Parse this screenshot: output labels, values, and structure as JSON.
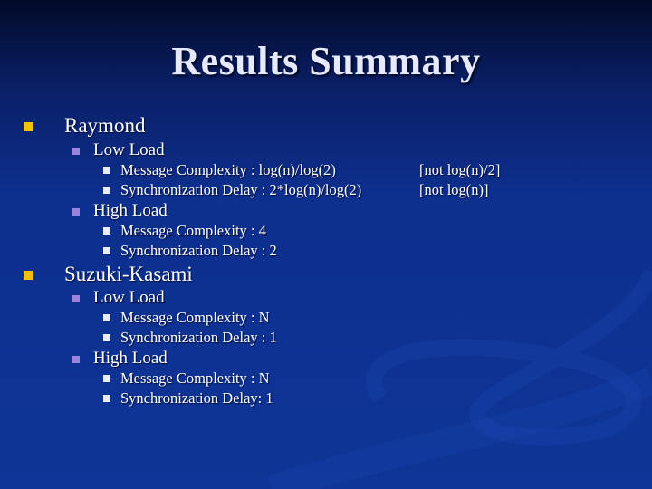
{
  "slide": {
    "title": "Results Summary",
    "sections": [
      {
        "label": "Raymond",
        "groups": [
          {
            "label": "Low Load",
            "items": [
              {
                "text": "Message Complexity : log(n)/log(2)",
                "note": "[not log(n)/2]"
              },
              {
                "text": "Synchronization Delay : 2*log(n)/log(2)",
                "note": "[not log(n)]"
              }
            ]
          },
          {
            "label": "High Load",
            "items": [
              {
                "text": "Message Complexity : 4"
              },
              {
                "text": "Synchronization Delay : 2"
              }
            ]
          }
        ]
      },
      {
        "label": "Suzuki-Kasami",
        "groups": [
          {
            "label": "Low Load",
            "items": [
              {
                "text": "Message Complexity : N"
              },
              {
                "text": "Synchronization Delay : 1"
              }
            ]
          },
          {
            "label": "High Load",
            "items": [
              {
                "text": "Message Complexity : N"
              },
              {
                "text": "Synchronization Delay: 1"
              }
            ]
          }
        ]
      }
    ]
  },
  "colors": {
    "level1_bullet": "#f2c20a",
    "level2_bullet": "#9a84e0",
    "level3_bullet": "#e8ecff",
    "title": "#e6e9ff"
  }
}
